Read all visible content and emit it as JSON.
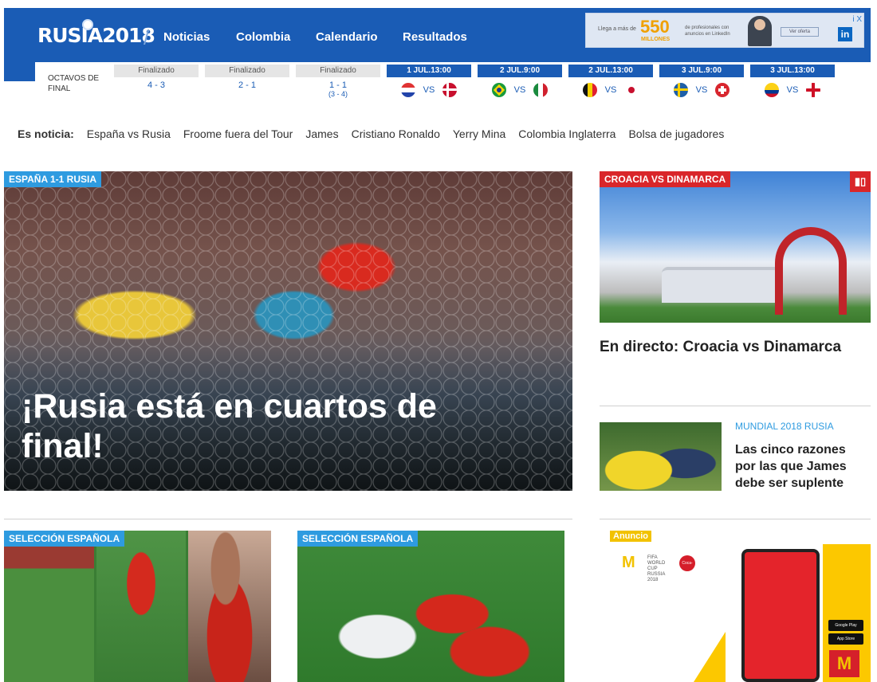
{
  "header": {
    "logo": "RUSIA2018",
    "nav": [
      "Noticias",
      "Colombia",
      "Calendario",
      "Resultados"
    ],
    "ad": {
      "line1": "Llega a más de",
      "number": "550",
      "unit": "MILLONES",
      "line2": "de profesionales con anuncios en LinkedIn",
      "button": "Ver oferta",
      "brand": "in",
      "adchoices": "i X"
    }
  },
  "scores": {
    "round": "OCTAVOS DE FINAL",
    "matches": [
      {
        "status": "Finalizado",
        "result": "4 - 3"
      },
      {
        "status": "Finalizado",
        "result": "2 - 1"
      },
      {
        "status": "Finalizado",
        "result": "1 - 1",
        "pens": "(3 - 4)"
      },
      {
        "date": "1 JUL.13:00",
        "vs": "VS"
      },
      {
        "date": "2 JUL.9:00",
        "vs": "VS"
      },
      {
        "date": "2 JUL.13:00",
        "vs": "VS"
      },
      {
        "date": "3 JUL.9:00",
        "vs": "VS"
      },
      {
        "date": "3 JUL.13:00",
        "vs": "VS"
      }
    ]
  },
  "trending": {
    "label": "Es noticia:",
    "items": [
      "España vs Rusia",
      "Froome fuera del Tour",
      "James",
      "Cristiano Ronaldo",
      "Yerry Mina",
      "Colombia Inglaterra",
      "Bolsa de jugadores"
    ]
  },
  "hero": {
    "tag": "ESPAÑA 1-1 RUSIA",
    "title": "¡Rusia está en cuartos de final!"
  },
  "side": {
    "live_tag": "CROACIA VS DINAMARCA",
    "live_title": "En directo: Croacia vs Dinamarca",
    "kicker": "MUNDIAL 2018 RUSIA",
    "story_title": "Las cinco razones por las que James debe ser suplente"
  },
  "bottom": {
    "card1_tag": "SELECCIÓN ESPAÑOLA",
    "card2_tag": "SELECCIÓN ESPAÑOLA"
  },
  "ad2": {
    "label": "Anuncio",
    "mc": "M",
    "fifa": "FIFA WORLD CUP RUSSIA 2018",
    "coke": "Coca-Cola",
    "google": "Google Play",
    "apple": "App Store"
  }
}
